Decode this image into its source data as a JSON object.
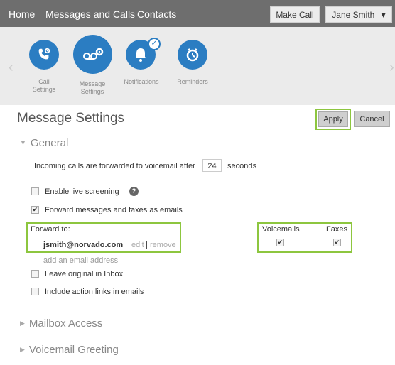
{
  "nav": {
    "home": "Home",
    "messages": "Messages and Calls",
    "contacts": "Contacts",
    "make_call": "Make Call",
    "user": "Jane Smith",
    "user_chevron": "▾"
  },
  "iconbar": {
    "left_arrow": "‹",
    "right_arrow": "›",
    "items": [
      {
        "label_line1": "Call",
        "label_line2": "Settings",
        "icon": "phone-gear-icon"
      },
      {
        "label_line1": "Message",
        "label_line2": "Settings",
        "icon": "voicemail-gear-icon"
      },
      {
        "label_line1": "Notifications",
        "label_line2": "",
        "icon": "bell-icon"
      },
      {
        "label_line1": "Reminders",
        "label_line2": "",
        "icon": "clock-icon"
      }
    ],
    "notification_badge": "✓"
  },
  "page": {
    "title": "Message Settings",
    "apply": "Apply",
    "cancel": "Cancel"
  },
  "general": {
    "heading": "General",
    "forward_text": "Incoming calls are forwarded to voicemail after",
    "seconds_value": "24",
    "seconds_label": "seconds",
    "live_screening": "Enable live screening",
    "forward_messages": "Forward messages and faxes as emails",
    "forward_to_label": "Forward to:",
    "email": "jsmith@norvado.com",
    "edit": "edit",
    "sep": "|",
    "remove": "remove",
    "add_email": "add an email address",
    "voicemails": "Voicemails",
    "faxes": "Faxes",
    "leave_original": "Leave original in Inbox",
    "include_links": "Include action links in emails",
    "check_mark": "✔"
  },
  "sections": {
    "mailbox": "Mailbox Access",
    "voicemail_greeting": "Voicemail Greeting"
  },
  "colors": {
    "accent": "#2b7dc2",
    "highlight": "#8dc63f",
    "topbar": "#6e6e6e"
  }
}
